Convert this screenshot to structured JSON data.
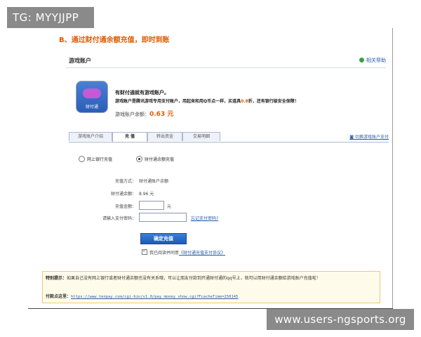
{
  "watermark": {
    "top_left": "TG: MYYJJPP",
    "bottom_right": "www.users-ngsports.org"
  },
  "step_title": "B、通过财付通余额充值，即时到账",
  "header": {
    "title": "游戏账户",
    "help_label": "相关帮助"
  },
  "account": {
    "icon_label": "财付通",
    "headline": "有财付通就有游戏账户。",
    "desc_before": "游戏账户是腾讯游戏专用支付账户，用起来和用Q币点一样，买道具",
    "desc_highlight": "0.8",
    "desc_after": "折，还有银行级安全保障！",
    "balance_label": "游戏账户余额：",
    "balance_value": "0.63 元"
  },
  "tabs": [
    {
      "label": "游戏账户介绍",
      "active": false
    },
    {
      "label": "充 值",
      "active": true
    },
    {
      "label": "转出资金",
      "active": false
    },
    {
      "label": "交易明细",
      "active": false
    }
  ],
  "switch_link": "切换游戏账户支付",
  "payment_options": [
    {
      "label": "网上银行充值",
      "selected": false
    },
    {
      "label": "财付通余额充值",
      "selected": true
    }
  ],
  "form": {
    "method_label": "充值方式：",
    "method_value": "财付通账户余额",
    "balance_label": "财付通余额：",
    "balance_value": "8.96 元",
    "amount_label": "充值金额：",
    "amount_value": "",
    "amount_unit": "元",
    "password_label": "请输入支付密码：",
    "password_value": "",
    "forgot_password": "忘记支付密码?"
  },
  "confirm_button": "确定充值",
  "agreement": {
    "prefix": "我已阅读并同意",
    "link": "《财付通充值支付协议》",
    "checked": true
  },
  "tip": {
    "label": "特别提示：",
    "text": "如果自己没有网上银行或者财付通余额也没有关系哦，可以让朋友付款到开通财付通的qq号上，就可以用财付通余额给游戏账户充值啦！",
    "pay_label": "付款点这里：",
    "pay_url": "https://www.tenpay.com/cgi-bin/v1.0/pay_money_show.cgi?FcacheTime=250145"
  }
}
